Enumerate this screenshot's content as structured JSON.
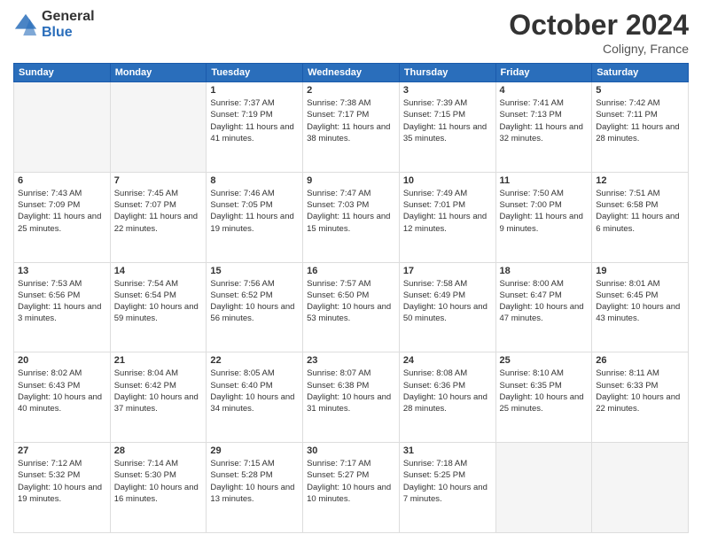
{
  "logo": {
    "general": "General",
    "blue": "Blue"
  },
  "header": {
    "title": "October 2024",
    "subtitle": "Coligny, France"
  },
  "weekdays": [
    "Sunday",
    "Monday",
    "Tuesday",
    "Wednesday",
    "Thursday",
    "Friday",
    "Saturday"
  ],
  "weeks": [
    [
      {
        "day": "",
        "info": ""
      },
      {
        "day": "",
        "info": ""
      },
      {
        "day": "1",
        "info": "Sunrise: 7:37 AM\nSunset: 7:19 PM\nDaylight: 11 hours and 41 minutes."
      },
      {
        "day": "2",
        "info": "Sunrise: 7:38 AM\nSunset: 7:17 PM\nDaylight: 11 hours and 38 minutes."
      },
      {
        "day": "3",
        "info": "Sunrise: 7:39 AM\nSunset: 7:15 PM\nDaylight: 11 hours and 35 minutes."
      },
      {
        "day": "4",
        "info": "Sunrise: 7:41 AM\nSunset: 7:13 PM\nDaylight: 11 hours and 32 minutes."
      },
      {
        "day": "5",
        "info": "Sunrise: 7:42 AM\nSunset: 7:11 PM\nDaylight: 11 hours and 28 minutes."
      }
    ],
    [
      {
        "day": "6",
        "info": "Sunrise: 7:43 AM\nSunset: 7:09 PM\nDaylight: 11 hours and 25 minutes."
      },
      {
        "day": "7",
        "info": "Sunrise: 7:45 AM\nSunset: 7:07 PM\nDaylight: 11 hours and 22 minutes."
      },
      {
        "day": "8",
        "info": "Sunrise: 7:46 AM\nSunset: 7:05 PM\nDaylight: 11 hours and 19 minutes."
      },
      {
        "day": "9",
        "info": "Sunrise: 7:47 AM\nSunset: 7:03 PM\nDaylight: 11 hours and 15 minutes."
      },
      {
        "day": "10",
        "info": "Sunrise: 7:49 AM\nSunset: 7:01 PM\nDaylight: 11 hours and 12 minutes."
      },
      {
        "day": "11",
        "info": "Sunrise: 7:50 AM\nSunset: 7:00 PM\nDaylight: 11 hours and 9 minutes."
      },
      {
        "day": "12",
        "info": "Sunrise: 7:51 AM\nSunset: 6:58 PM\nDaylight: 11 hours and 6 minutes."
      }
    ],
    [
      {
        "day": "13",
        "info": "Sunrise: 7:53 AM\nSunset: 6:56 PM\nDaylight: 11 hours and 3 minutes."
      },
      {
        "day": "14",
        "info": "Sunrise: 7:54 AM\nSunset: 6:54 PM\nDaylight: 10 hours and 59 minutes."
      },
      {
        "day": "15",
        "info": "Sunrise: 7:56 AM\nSunset: 6:52 PM\nDaylight: 10 hours and 56 minutes."
      },
      {
        "day": "16",
        "info": "Sunrise: 7:57 AM\nSunset: 6:50 PM\nDaylight: 10 hours and 53 minutes."
      },
      {
        "day": "17",
        "info": "Sunrise: 7:58 AM\nSunset: 6:49 PM\nDaylight: 10 hours and 50 minutes."
      },
      {
        "day": "18",
        "info": "Sunrise: 8:00 AM\nSunset: 6:47 PM\nDaylight: 10 hours and 47 minutes."
      },
      {
        "day": "19",
        "info": "Sunrise: 8:01 AM\nSunset: 6:45 PM\nDaylight: 10 hours and 43 minutes."
      }
    ],
    [
      {
        "day": "20",
        "info": "Sunrise: 8:02 AM\nSunset: 6:43 PM\nDaylight: 10 hours and 40 minutes."
      },
      {
        "day": "21",
        "info": "Sunrise: 8:04 AM\nSunset: 6:42 PM\nDaylight: 10 hours and 37 minutes."
      },
      {
        "day": "22",
        "info": "Sunrise: 8:05 AM\nSunset: 6:40 PM\nDaylight: 10 hours and 34 minutes."
      },
      {
        "day": "23",
        "info": "Sunrise: 8:07 AM\nSunset: 6:38 PM\nDaylight: 10 hours and 31 minutes."
      },
      {
        "day": "24",
        "info": "Sunrise: 8:08 AM\nSunset: 6:36 PM\nDaylight: 10 hours and 28 minutes."
      },
      {
        "day": "25",
        "info": "Sunrise: 8:10 AM\nSunset: 6:35 PM\nDaylight: 10 hours and 25 minutes."
      },
      {
        "day": "26",
        "info": "Sunrise: 8:11 AM\nSunset: 6:33 PM\nDaylight: 10 hours and 22 minutes."
      }
    ],
    [
      {
        "day": "27",
        "info": "Sunrise: 7:12 AM\nSunset: 5:32 PM\nDaylight: 10 hours and 19 minutes."
      },
      {
        "day": "28",
        "info": "Sunrise: 7:14 AM\nSunset: 5:30 PM\nDaylight: 10 hours and 16 minutes."
      },
      {
        "day": "29",
        "info": "Sunrise: 7:15 AM\nSunset: 5:28 PM\nDaylight: 10 hours and 13 minutes."
      },
      {
        "day": "30",
        "info": "Sunrise: 7:17 AM\nSunset: 5:27 PM\nDaylight: 10 hours and 10 minutes."
      },
      {
        "day": "31",
        "info": "Sunrise: 7:18 AM\nSunset: 5:25 PM\nDaylight: 10 hours and 7 minutes."
      },
      {
        "day": "",
        "info": ""
      },
      {
        "day": "",
        "info": ""
      }
    ]
  ]
}
